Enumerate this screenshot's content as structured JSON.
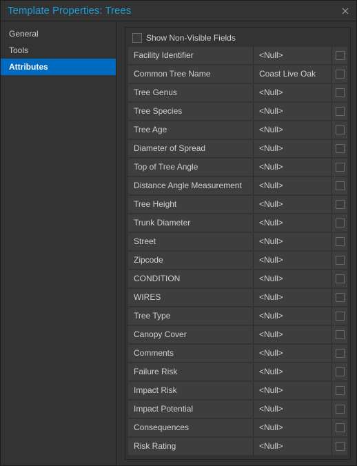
{
  "window": {
    "title": "Template Properties: Trees"
  },
  "sidebar": {
    "items": [
      {
        "label": "General"
      },
      {
        "label": "Tools"
      },
      {
        "label": "Attributes"
      }
    ],
    "selected_index": 2
  },
  "main": {
    "show_nonvisible_label": "Show Non-Visible Fields",
    "attributes": [
      {
        "label": "Facility Identifier",
        "value": "<Null>"
      },
      {
        "label": "Common Tree Name",
        "value": "Coast Live Oak"
      },
      {
        "label": "Tree Genus",
        "value": "<Null>"
      },
      {
        "label": "Tree Species",
        "value": "<Null>"
      },
      {
        "label": "Tree Age",
        "value": "<Null>"
      },
      {
        "label": "Diameter of Spread",
        "value": "<Null>"
      },
      {
        "label": "Top of Tree Angle",
        "value": "<Null>"
      },
      {
        "label": "Distance Angle Measurement",
        "value": "<Null>"
      },
      {
        "label": "Tree Height",
        "value": "<Null>"
      },
      {
        "label": "Trunk Diameter",
        "value": "<Null>"
      },
      {
        "label": "Street",
        "value": "<Null>"
      },
      {
        "label": "Zipcode",
        "value": "<Null>"
      },
      {
        "label": "CONDITION",
        "value": "<Null>"
      },
      {
        "label": "WIRES",
        "value": "<Null>"
      },
      {
        "label": "Tree Type",
        "value": "<Null>"
      },
      {
        "label": "Canopy Cover",
        "value": "<Null>"
      },
      {
        "label": "Comments",
        "value": "<Null>"
      },
      {
        "label": "Failure Risk",
        "value": "<Null>"
      },
      {
        "label": "Impact Risk",
        "value": "<Null>"
      },
      {
        "label": "Impact Potential",
        "value": "<Null>"
      },
      {
        "label": "Consequences",
        "value": "<Null>"
      },
      {
        "label": "Risk Rating",
        "value": "<Null>"
      }
    ]
  }
}
